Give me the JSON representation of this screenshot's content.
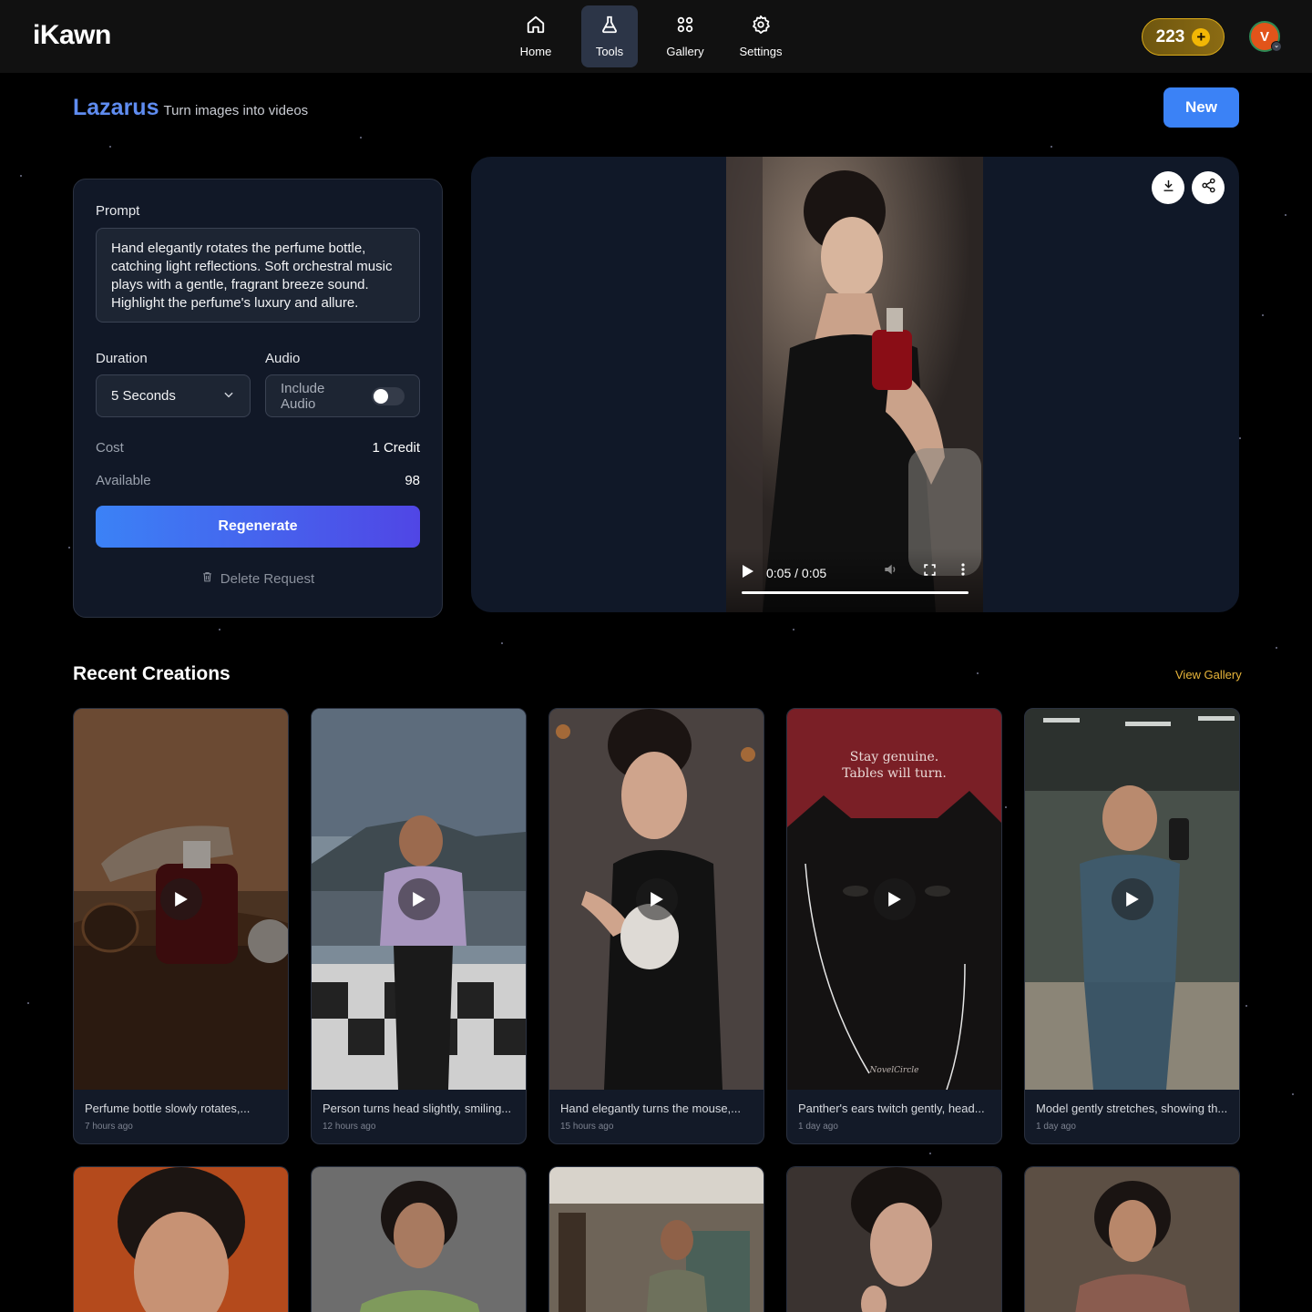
{
  "brand": {
    "logo": "iKawn"
  },
  "nav": [
    {
      "label": "Home",
      "icon": "home-icon",
      "active": false
    },
    {
      "label": "Tools",
      "icon": "flask-icon",
      "active": true
    },
    {
      "label": "Gallery",
      "icon": "grid-icon",
      "active": false
    },
    {
      "label": "Settings",
      "icon": "gear-icon",
      "active": false
    }
  ],
  "header": {
    "credits": "223",
    "avatar_initial": "V"
  },
  "page": {
    "title": "Lazarus",
    "subtitle": "Turn images into videos",
    "new_label": "New"
  },
  "form": {
    "prompt_label": "Prompt",
    "prompt_text": "Hand elegantly rotates the perfume bottle, catching light reflections. Soft orchestral music plays with a gentle, fragrant breeze sound. Highlight the perfume's luxury and allure.",
    "duration_label": "Duration",
    "duration_value": "5 Seconds",
    "audio_label": "Audio",
    "audio_toggle_label": "Include Audio",
    "audio_enabled": false,
    "cost_label": "Cost",
    "cost_value": "1 Credit",
    "available_label": "Available",
    "available_value": "98",
    "regenerate_label": "Regenerate",
    "delete_label": "Delete Request"
  },
  "player": {
    "time": "0:05 / 0:05",
    "progress": 1.0
  },
  "recent": {
    "title": "Recent Creations",
    "view_gallery": "View Gallery",
    "items": [
      {
        "caption": "Perfume bottle slowly rotates,...",
        "time": "7 hours ago"
      },
      {
        "caption": "Person turns head slightly, smiling...",
        "time": "12 hours ago"
      },
      {
        "caption": "Hand elegantly turns the mouse,...",
        "time": "15 hours ago"
      },
      {
        "caption": "Panther's ears twitch gently, head...",
        "time": "1 day ago",
        "overlay": [
          "Stay genuine.",
          "Tables will turn."
        ],
        "signature": "NovelCircle"
      },
      {
        "caption": "Model gently stretches, showing th...",
        "time": "1 day ago"
      }
    ]
  },
  "colors": {
    "accent": "#3b82f6",
    "gold": "#d8a919",
    "panel": "#111827",
    "link": "#e8b53a"
  }
}
